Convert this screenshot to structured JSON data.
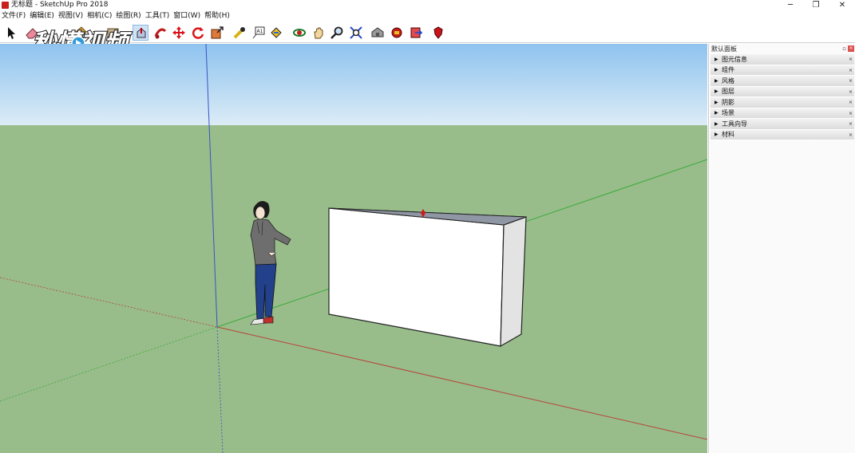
{
  "window": {
    "title": "无标题 - SketchUp Pro 2018",
    "minimize": "─",
    "restore": "❐",
    "close": "✕"
  },
  "menu": [
    {
      "label": "文件(F)"
    },
    {
      "label": "编辑(E)"
    },
    {
      "label": "视图(V)"
    },
    {
      "label": "相机(C)"
    },
    {
      "label": "绘图(R)"
    },
    {
      "label": "工具(T)"
    },
    {
      "label": "窗口(W)"
    },
    {
      "label": "帮助(H)"
    }
  ],
  "toolbar": {
    "tools": [
      {
        "name": "select-tool",
        "icon": "arrow-icon"
      },
      {
        "name": "eraser-tool",
        "icon": "eraser-icon"
      },
      {
        "name": "paint-tool",
        "icon": "paint-bucket-icon"
      },
      {
        "name": "line-tool",
        "icon": "pencil-icon"
      },
      {
        "name": "rectangle-tool",
        "icon": "rectangle-icon"
      },
      {
        "name": "push-pull-tool",
        "icon": "push-pull-icon"
      },
      {
        "name": "follow-me-tool",
        "icon": "follow-me-icon"
      },
      {
        "name": "move-tool",
        "icon": "move-icon"
      },
      {
        "name": "rotate-tool",
        "icon": "rotate-icon"
      },
      {
        "name": "scale-tool",
        "icon": "scale-icon"
      },
      {
        "name": "tape-measure-tool",
        "icon": "tape-measure-icon"
      },
      {
        "name": "text-tool",
        "icon": "text-icon"
      },
      {
        "name": "paint-bucket-tool",
        "icon": "paint-icon"
      },
      {
        "name": "orbit-tool",
        "icon": "orbit-icon"
      },
      {
        "name": "pan-tool",
        "icon": "hand-icon"
      },
      {
        "name": "zoom-tool",
        "icon": "magnifier-icon"
      },
      {
        "name": "zoom-extents-tool",
        "icon": "zoom-extents-icon"
      },
      {
        "name": "warehouse-tool",
        "icon": "warehouse-icon"
      },
      {
        "name": "extension-warehouse-tool",
        "icon": "extension-icon"
      },
      {
        "name": "send-to-layout-tool",
        "icon": "layout-icon"
      },
      {
        "name": "ruby-console-tool",
        "icon": "ruby-icon"
      }
    ]
  },
  "watermark": {
    "text": "秒懂视频"
  },
  "tray": {
    "title": "默认面板",
    "pin": "▫",
    "close": "×",
    "panels": [
      {
        "label": "图元信息"
      },
      {
        "label": "组件"
      },
      {
        "label": "风格"
      },
      {
        "label": "图层"
      },
      {
        "label": "阴影"
      },
      {
        "label": "场景"
      },
      {
        "label": "工具向导"
      },
      {
        "label": "材料"
      }
    ]
  },
  "colors": {
    "sky_top": "#8ec3ef",
    "sky_bottom": "#dcecf6",
    "ground": "#98bd8a",
    "box_front": "#ffffff",
    "box_side": "#e3e3e3",
    "box_top": "#8f96a4",
    "axis_red": "#b8443a",
    "axis_green": "#3da83d",
    "axis_blue": "#3a52c4"
  }
}
